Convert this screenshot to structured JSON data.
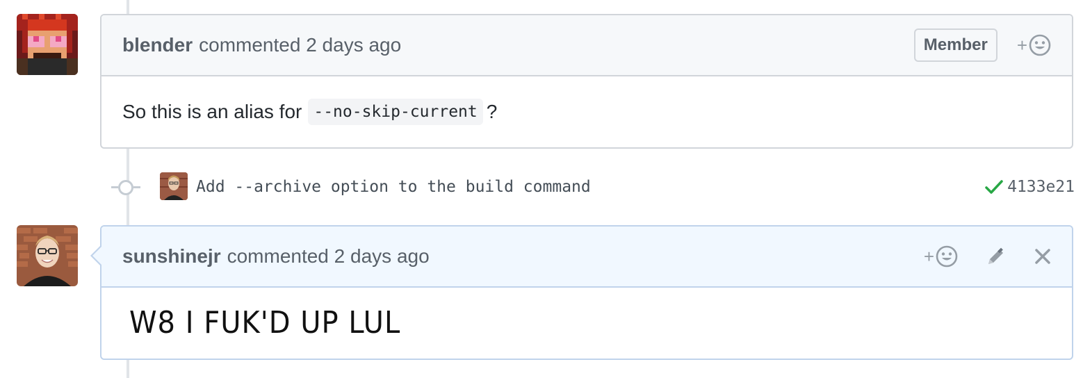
{
  "comments": [
    {
      "author": "blender",
      "meta": "commented 2 days ago",
      "badge": "Member",
      "body_prefix": "So this is an alias for",
      "body_code": "--no-skip-current",
      "body_suffix": "?"
    },
    {
      "author": "sunshinejr",
      "meta": "commented 2 days ago",
      "body": "W8 I FUK'D UP LUL"
    }
  ],
  "commit": {
    "message": "Add --archive option to the build command",
    "sha": "4133e21",
    "status_icon": "check-icon",
    "status_color": "#28a745"
  },
  "icons": {
    "reaction": "smiley-icon",
    "reaction_plus": "+",
    "edit": "pencil-icon",
    "delete": "x-icon"
  }
}
